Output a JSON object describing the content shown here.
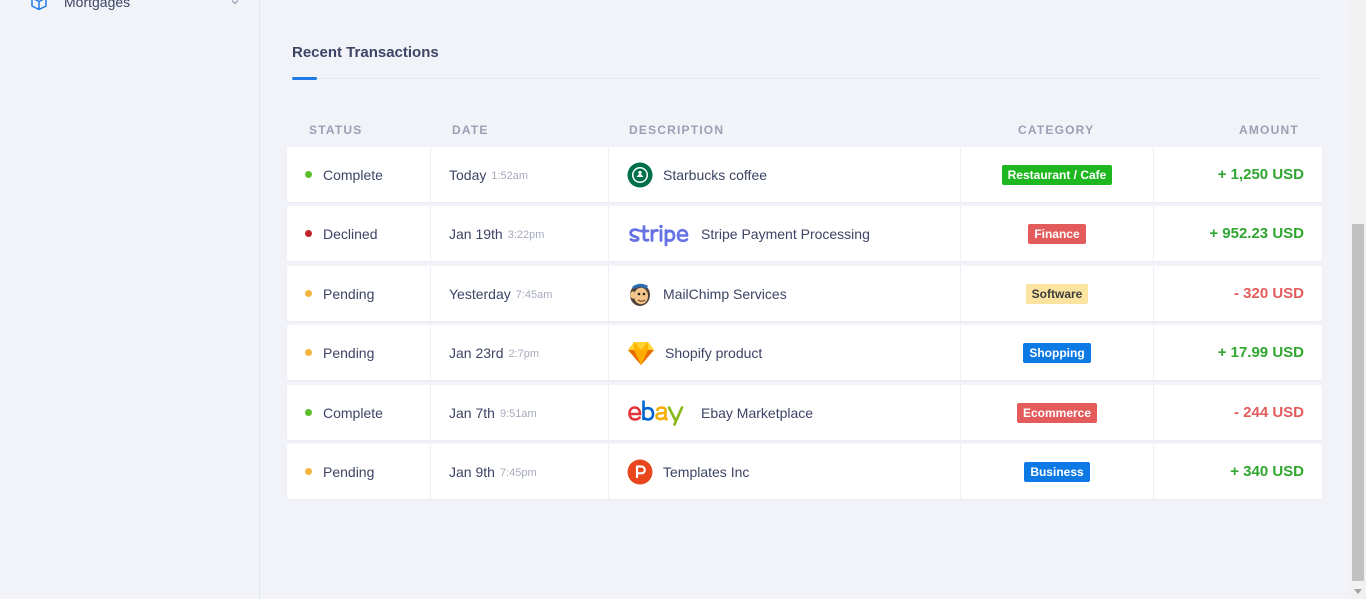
{
  "sidebar": {
    "items": [
      {
        "label": "Mortgages",
        "icon": "cube-icon"
      }
    ]
  },
  "transactions": {
    "title": "Recent Transactions",
    "columns": [
      "Status",
      "Date",
      "Description",
      "Category",
      "Amount"
    ],
    "rows": [
      {
        "status": "Complete",
        "status_color": "#5bbd2b",
        "date": "Today",
        "time": "1:52am",
        "logo": "starbucks-logo-icon",
        "description": "Starbucks coffee",
        "category": "Restaurant / Cafe",
        "category_color": "#1fb71f",
        "category_text_color": "#ffffff",
        "amount": "+ 1,250 USD",
        "amount_color": "#2fa62f"
      },
      {
        "status": "Declined",
        "status_color": "#c3242b",
        "date": "Jan 19th",
        "time": "3:22pm",
        "logo": "stripe-logo-icon",
        "description": "Stripe Payment Processing",
        "category": "Finance",
        "category_color": "#e35b5b",
        "category_text_color": "#ffffff",
        "amount": "+ 952.23 USD",
        "amount_color": "#2fa62f"
      },
      {
        "status": "Pending",
        "status_color": "#f5b43d",
        "date": "Yesterday",
        "time": "7:45am",
        "logo": "mailchimp-logo-icon",
        "description": "MailChimp Services",
        "category": "Software",
        "category_color": "#fbe4a0",
        "category_text_color": "#3d3d3d",
        "amount": "- 320 USD",
        "amount_color": "#e35b5b"
      },
      {
        "status": "Pending",
        "status_color": "#f5b43d",
        "date": "Jan 23rd",
        "time": "2:7pm",
        "logo": "sketch-logo-icon",
        "description": "Shopify product",
        "category": "Shopping",
        "category_color": "#0d79e4",
        "category_text_color": "#ffffff",
        "amount": "+ 17.99 USD",
        "amount_color": "#2fa62f"
      },
      {
        "status": "Complete",
        "status_color": "#5bbd2b",
        "date": "Jan 7th",
        "time": "9:51am",
        "logo": "ebay-logo-icon",
        "description": "Ebay Marketplace",
        "category": "Ecommerce",
        "category_color": "#e35b5b",
        "category_text_color": "#ffffff",
        "amount": "- 244 USD",
        "amount_color": "#e35b5b"
      },
      {
        "status": "Pending",
        "status_color": "#f5b43d",
        "date": "Jan 9th",
        "time": "7:45pm",
        "logo": "producthunt-logo-icon",
        "description": "Templates Inc",
        "category": "Business",
        "category_color": "#0d79e4",
        "category_text_color": "#ffffff",
        "amount": "+ 340 USD",
        "amount_color": "#2fa62f"
      }
    ]
  },
  "colors": {
    "accent": "#1e7be6",
    "background": "#f2f3f8",
    "text": "#3d4465",
    "muted": "#9aa0b4"
  }
}
